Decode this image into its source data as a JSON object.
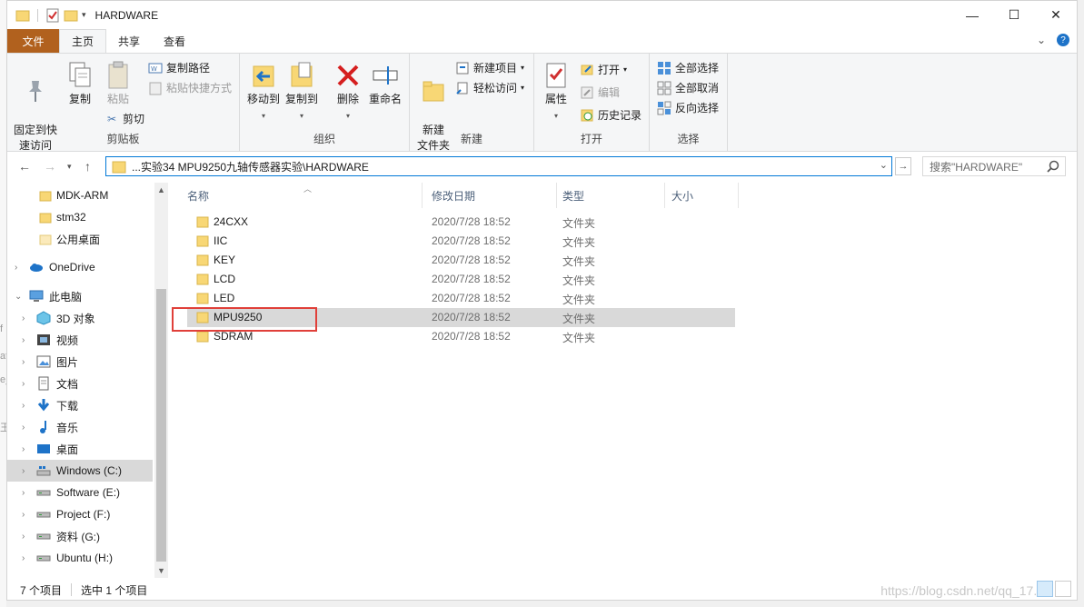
{
  "window": {
    "title": "HARDWARE"
  },
  "tabs": [
    "文件",
    "主页",
    "共享",
    "查看"
  ],
  "ribbon": {
    "clipboard": {
      "pin": "固定到快\n速访问",
      "copy": "复制",
      "paste": "粘贴",
      "copy_path": "复制路径",
      "paste_shortcut": "粘贴快捷方式",
      "cut": "剪切",
      "label": "剪贴板"
    },
    "organize": {
      "move_to": "移动到",
      "copy_to": "复制到",
      "delete": "删除",
      "rename": "重命名",
      "label": "组织"
    },
    "new": {
      "new_folder": "新建\n文件夹",
      "new_item": "新建项目",
      "easy_access": "轻松访问",
      "label": "新建"
    },
    "open": {
      "properties": "属性",
      "open": "打开",
      "edit": "编辑",
      "history": "历史记录",
      "label": "打开"
    },
    "select": {
      "select_all": "全部选择",
      "select_none": "全部取消",
      "invert": "反向选择",
      "label": "选择"
    }
  },
  "address": {
    "path": "...实验34 MPU9250九轴传感器实验\\HARDWARE"
  },
  "search": {
    "placeholder": "搜索\"HARDWARE\""
  },
  "nav": {
    "items": [
      {
        "label": "MDK-ARM",
        "icon": "folder-icon"
      },
      {
        "label": "stm32",
        "icon": "folder-icon"
      },
      {
        "label": "公用桌面",
        "icon": "folder-light-icon"
      },
      {
        "label": "OneDrive",
        "icon": "cloud-icon"
      },
      {
        "label": "此电脑",
        "icon": "computer-icon"
      },
      {
        "label": "3D 对象",
        "icon": "cube-icon"
      },
      {
        "label": "视频",
        "icon": "video-icon"
      },
      {
        "label": "图片",
        "icon": "picture-icon"
      },
      {
        "label": "文档",
        "icon": "document-icon"
      },
      {
        "label": "下载",
        "icon": "download-icon"
      },
      {
        "label": "音乐",
        "icon": "music-icon"
      },
      {
        "label": "桌面",
        "icon": "desktop-icon"
      },
      {
        "label": "Windows (C:)",
        "icon": "drive-windows-icon"
      },
      {
        "label": "Software (E:)",
        "icon": "drive-icon"
      },
      {
        "label": "Project (F:)",
        "icon": "drive-icon"
      },
      {
        "label": "资料 (G:)",
        "icon": "drive-icon"
      },
      {
        "label": "Ubuntu (H:)",
        "icon": "drive-icon"
      }
    ]
  },
  "files": {
    "columns": [
      "名称",
      "修改日期",
      "类型",
      "大小"
    ],
    "rows": [
      {
        "name": "24CXX",
        "date": "2020/7/28 18:52",
        "type": "文件夹"
      },
      {
        "name": "IIC",
        "date": "2020/7/28 18:52",
        "type": "文件夹"
      },
      {
        "name": "KEY",
        "date": "2020/7/28 18:52",
        "type": "文件夹"
      },
      {
        "name": "LCD",
        "date": "2020/7/28 18:52",
        "type": "文件夹"
      },
      {
        "name": "LED",
        "date": "2020/7/28 18:52",
        "type": "文件夹"
      },
      {
        "name": "MPU9250",
        "date": "2020/7/28 18:52",
        "type": "文件夹"
      },
      {
        "name": "SDRAM",
        "date": "2020/7/28 18:52",
        "type": "文件夹"
      }
    ]
  },
  "status": {
    "count": "7 个项目",
    "selected": "选中 1 个项目"
  },
  "watermark": "https://blog.csdn.net/qq_17..."
}
